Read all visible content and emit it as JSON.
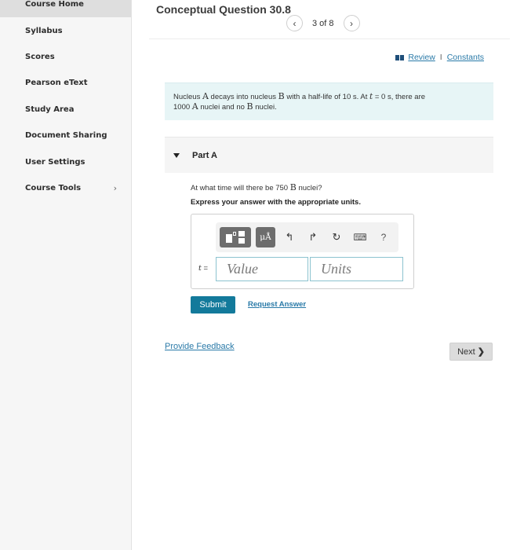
{
  "sidebar": {
    "items": [
      {
        "label": "Course Home",
        "active": true
      },
      {
        "label": "Syllabus"
      },
      {
        "label": "Scores"
      },
      {
        "label": "Pearson eText"
      },
      {
        "label": "Study Area"
      },
      {
        "label": "Document Sharing"
      },
      {
        "label": "User Settings"
      },
      {
        "label": "Course Tools",
        "has_submenu": true,
        "submenu_icon": "chevron-right-icon",
        "submenu_glyph": "›"
      }
    ]
  },
  "header": {
    "title": "Conceptual Question 30.8",
    "pager": {
      "prev_glyph": "‹",
      "text": "3 of 8",
      "next_glyph": "›"
    },
    "links": {
      "review": "Review",
      "separator": "I",
      "constants": "Constants"
    }
  },
  "problem": {
    "t1": "Nucleus ",
    "A1": "A",
    "t2": " decays into nucleus ",
    "B1": "B",
    "t3": " with a half-life of 10 s. At ",
    "tvar": "t",
    "t4": " = 0 s, there are",
    "t5": "1000 ",
    "A2": "A",
    "t6": " nuclei and no ",
    "B2": "B",
    "t7": " nuclei."
  },
  "part_a": {
    "label": "Part A",
    "question_pre": "At what time will there be 750 ",
    "question_var": "B",
    "question_post": " nuclei?",
    "instruction": "Express your answer with the appropriate units.",
    "toolbar": {
      "units_label": "μÅ",
      "undo_glyph": "↰",
      "redo_glyph": "↱",
      "reset_glyph": "↻",
      "keyboard_glyph": "⌨",
      "help_glyph": "?"
    },
    "answer_label_var": "t",
    "answer_label_eq": " =",
    "value_placeholder": "Value",
    "units_placeholder": "Units",
    "submit_label": "Submit",
    "request_answer_label": "Request Answer"
  },
  "footer": {
    "feedback_label": "Provide Feedback",
    "next_label": "Next",
    "next_glyph": "❯"
  },
  "colors": {
    "accent": "#137a9b",
    "link": "#2a7aa8",
    "problem_bg": "#e7f5f6",
    "input_border": "#8cc3cf"
  }
}
